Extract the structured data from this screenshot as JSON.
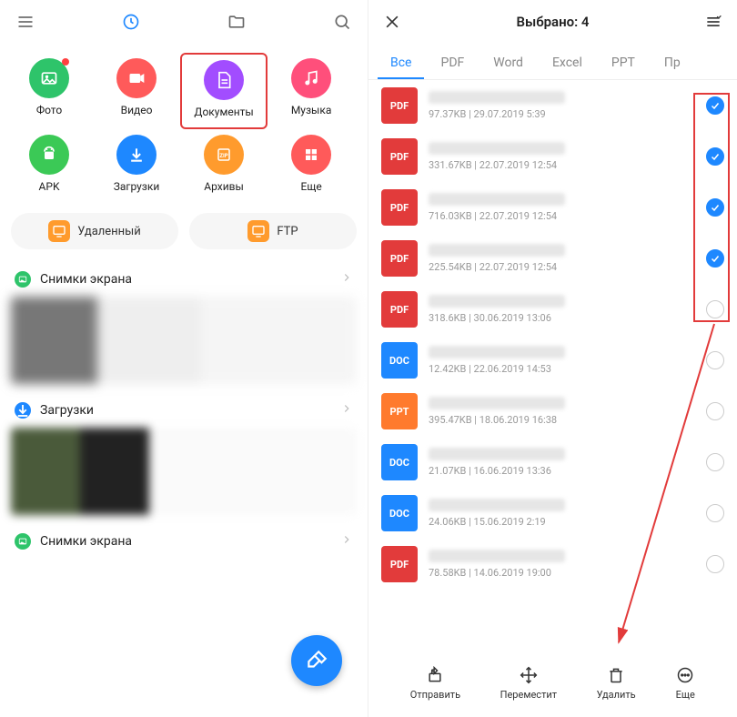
{
  "colors": {
    "blue": "#1e88ff",
    "annotation": "#e23b3b",
    "photo": "#2ec46a",
    "video": "#ff5a5a",
    "docs": "#a24dff",
    "music": "#ff4f7b",
    "apk": "#3bc956",
    "download": "#1e88ff",
    "zip": "#ff9b2d",
    "more": "#ff5a5a",
    "remote": "#ff9b2d",
    "ftp": "#ff9b2d",
    "pdf": "#e23b3b",
    "doc": "#1e88ff",
    "ppt": "#ff7a2d",
    "screenshots": "#2ec46a",
    "downloads": "#1e88ff"
  },
  "left": {
    "categories": [
      {
        "key": "photo",
        "label": "Фото",
        "icon": "photo",
        "color": "photo",
        "dot": true
      },
      {
        "key": "video",
        "label": "Видео",
        "icon": "video",
        "color": "video"
      },
      {
        "key": "docs",
        "label": "Документы",
        "icon": "doc",
        "color": "docs",
        "highlighted": true
      },
      {
        "key": "music",
        "label": "Музыка",
        "icon": "music",
        "color": "music"
      },
      {
        "key": "apk",
        "label": "APK",
        "icon": "android",
        "color": "apk"
      },
      {
        "key": "downloads",
        "label": "Загрузки",
        "icon": "download",
        "color": "download"
      },
      {
        "key": "archives",
        "label": "Архивы",
        "icon": "zip",
        "color": "zip"
      },
      {
        "key": "more",
        "label": "Еще",
        "icon": "grid",
        "color": "more"
      }
    ],
    "pills": [
      {
        "key": "remote",
        "label": "Удаленный",
        "icon": "screen",
        "color": "remote"
      },
      {
        "key": "ftp",
        "label": "FTP",
        "icon": "screen",
        "color": "ftp"
      }
    ],
    "sections": [
      {
        "key": "screenshots1",
        "label": "Снимки экрана",
        "color": "screenshots",
        "icon": "image"
      },
      {
        "key": "downloads",
        "label": "Загрузки",
        "color": "downloads",
        "icon": "download"
      },
      {
        "key": "screenshots2",
        "label": "Снимки экрана",
        "color": "screenshots",
        "icon": "image"
      }
    ]
  },
  "right": {
    "title": "Выбрано: 4",
    "tabs": [
      {
        "key": "all",
        "label": "Все",
        "active": true
      },
      {
        "key": "pdf",
        "label": "PDF"
      },
      {
        "key": "word",
        "label": "Word"
      },
      {
        "key": "excel",
        "label": "Excel"
      },
      {
        "key": "ppt",
        "label": "PPT"
      },
      {
        "key": "other",
        "label": "Пр"
      }
    ],
    "files": [
      {
        "type": "PDF",
        "color": "pdf",
        "size": "97.37KB",
        "date": "29.07.2019 5:39",
        "selected": true
      },
      {
        "type": "PDF",
        "color": "pdf",
        "size": "331.67KB",
        "date": "22.07.2019 12:54",
        "selected": true
      },
      {
        "type": "PDF",
        "color": "pdf",
        "size": "716.03KB",
        "date": "22.07.2019 12:54",
        "selected": true
      },
      {
        "type": "PDF",
        "color": "pdf",
        "size": "225.54KB",
        "date": "22.07.2019 12:54",
        "selected": true
      },
      {
        "type": "PDF",
        "color": "pdf",
        "size": "318.6KB",
        "date": "30.06.2019 13:06",
        "selected": false
      },
      {
        "type": "DOC",
        "color": "doc",
        "size": "12.42KB",
        "date": "22.06.2019 14:53",
        "selected": false
      },
      {
        "type": "PPT",
        "color": "ppt",
        "size": "395.47KB",
        "date": "18.06.2019 16:38",
        "selected": false
      },
      {
        "type": "DOC",
        "color": "doc",
        "size": "21.07KB",
        "date": "16.06.2019 13:36",
        "selected": false
      },
      {
        "type": "DOC",
        "color": "doc",
        "size": "24.06KB",
        "date": "15.06.2019 2:19",
        "selected": false
      },
      {
        "type": "PDF",
        "color": "pdf",
        "size": "78.58KB",
        "date": "14.06.2019 19:00",
        "selected": false
      }
    ],
    "actions": [
      {
        "key": "send",
        "label": "Отправить",
        "icon": "share"
      },
      {
        "key": "move",
        "label": "Переместит",
        "icon": "move"
      },
      {
        "key": "delete",
        "label": "Удалить",
        "icon": "trash"
      },
      {
        "key": "more",
        "label": "Еще",
        "icon": "more"
      }
    ]
  }
}
